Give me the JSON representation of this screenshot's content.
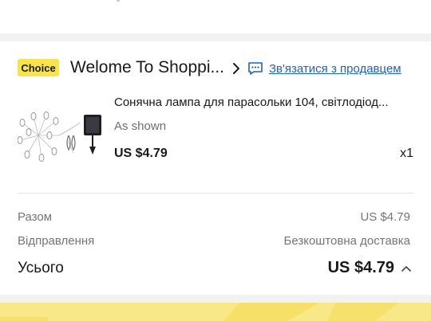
{
  "store": {
    "badge": "Choice",
    "name": "Welome To Shoppi...",
    "contact_label": "Зв'язатися з продавцем",
    "icons": {
      "chevron": "chevron-right-icon",
      "contact": "chat-icon"
    }
  },
  "product": {
    "title": "Сонячна лампа для парасольки 104, світлодіод...",
    "variant": "As shown",
    "price": "US $4.79",
    "quantity": "x1"
  },
  "summary": {
    "subtotal_label": "Разом",
    "subtotal_value": "US $4.79",
    "shipping_label": "Відправлення",
    "shipping_value": "Безкоштовна доставка",
    "total_label": "Усього",
    "total_value": "US $4.79"
  },
  "colors": {
    "badge": "#f9e34a",
    "link": "#1f5fd1",
    "banner": "#f9e888",
    "muted_text": "#757575"
  }
}
